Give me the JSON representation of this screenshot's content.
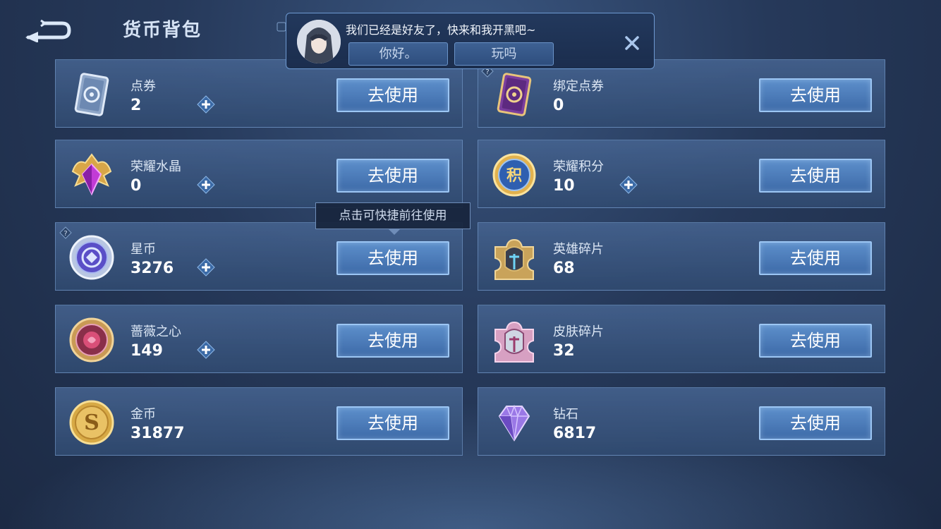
{
  "header": {
    "title": "货币背包",
    "back_icon": "back-arrow-icon"
  },
  "friend_popup": {
    "message": "我们已经是好友了，快来和我开黑吧~",
    "reply_1": "你好。",
    "reply_2": "玩吗",
    "close_icon": "close-icon"
  },
  "tooltip": {
    "text": "点击可快捷前往使用"
  },
  "button_label": "去使用",
  "currencies": [
    {
      "name": "点券",
      "count": "2",
      "icon": "coupon-ticket-icon",
      "has_plus": true
    },
    {
      "name": "绑定点券",
      "count": "0",
      "icon": "bound-coupon-ticket-icon",
      "has_plus": false
    },
    {
      "name": "荣耀水晶",
      "count": "0",
      "icon": "glory-crystal-icon",
      "has_plus": true
    },
    {
      "name": "荣耀积分",
      "count": "10",
      "icon": "glory-points-icon",
      "has_plus": true
    },
    {
      "name": "星币",
      "count": "3276",
      "icon": "star-coin-icon",
      "has_plus": true
    },
    {
      "name": "英雄碎片",
      "count": "68",
      "icon": "hero-fragment-icon",
      "has_plus": false
    },
    {
      "name": "蔷薇之心",
      "count": "149",
      "icon": "rose-heart-icon",
      "has_plus": true
    },
    {
      "name": "皮肤碎片",
      "count": "32",
      "icon": "skin-fragment-icon",
      "has_plus": false
    },
    {
      "name": "金币",
      "count": "31877",
      "icon": "gold-coin-icon",
      "has_plus": false
    },
    {
      "name": "钻石",
      "count": "6817",
      "icon": "diamond-icon",
      "has_plus": false
    }
  ],
  "colors": {
    "background": "#26395a",
    "card": "#3e628f",
    "button": "#4a7bbc",
    "accent": "#9cc6f4"
  }
}
